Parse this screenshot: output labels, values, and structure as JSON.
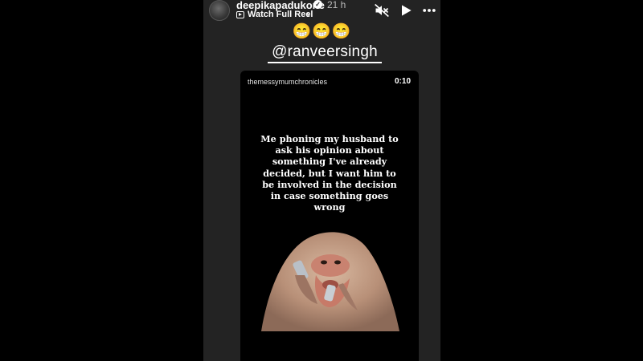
{
  "story": {
    "username": "deepikapadukone",
    "time": "21 h",
    "watch_label": "Watch Full Reel",
    "emoji_text": "😁😁😁",
    "mention": "@ranveersingh"
  },
  "controls": {
    "icons": [
      "volume-mute-icon",
      "play-icon",
      "more-options-icon"
    ]
  },
  "reel": {
    "source_user": "themessymumchronicles",
    "duration": "0:10",
    "caption": "Me phoning my husband to ask his opinion about something I've already decided, but I want him to be involved in the decision in case something goes wrong"
  },
  "colors": {
    "background": "#000000",
    "story_panel": "#232323",
    "text": "#ffffff",
    "muted_text": "#bbbbbb"
  }
}
